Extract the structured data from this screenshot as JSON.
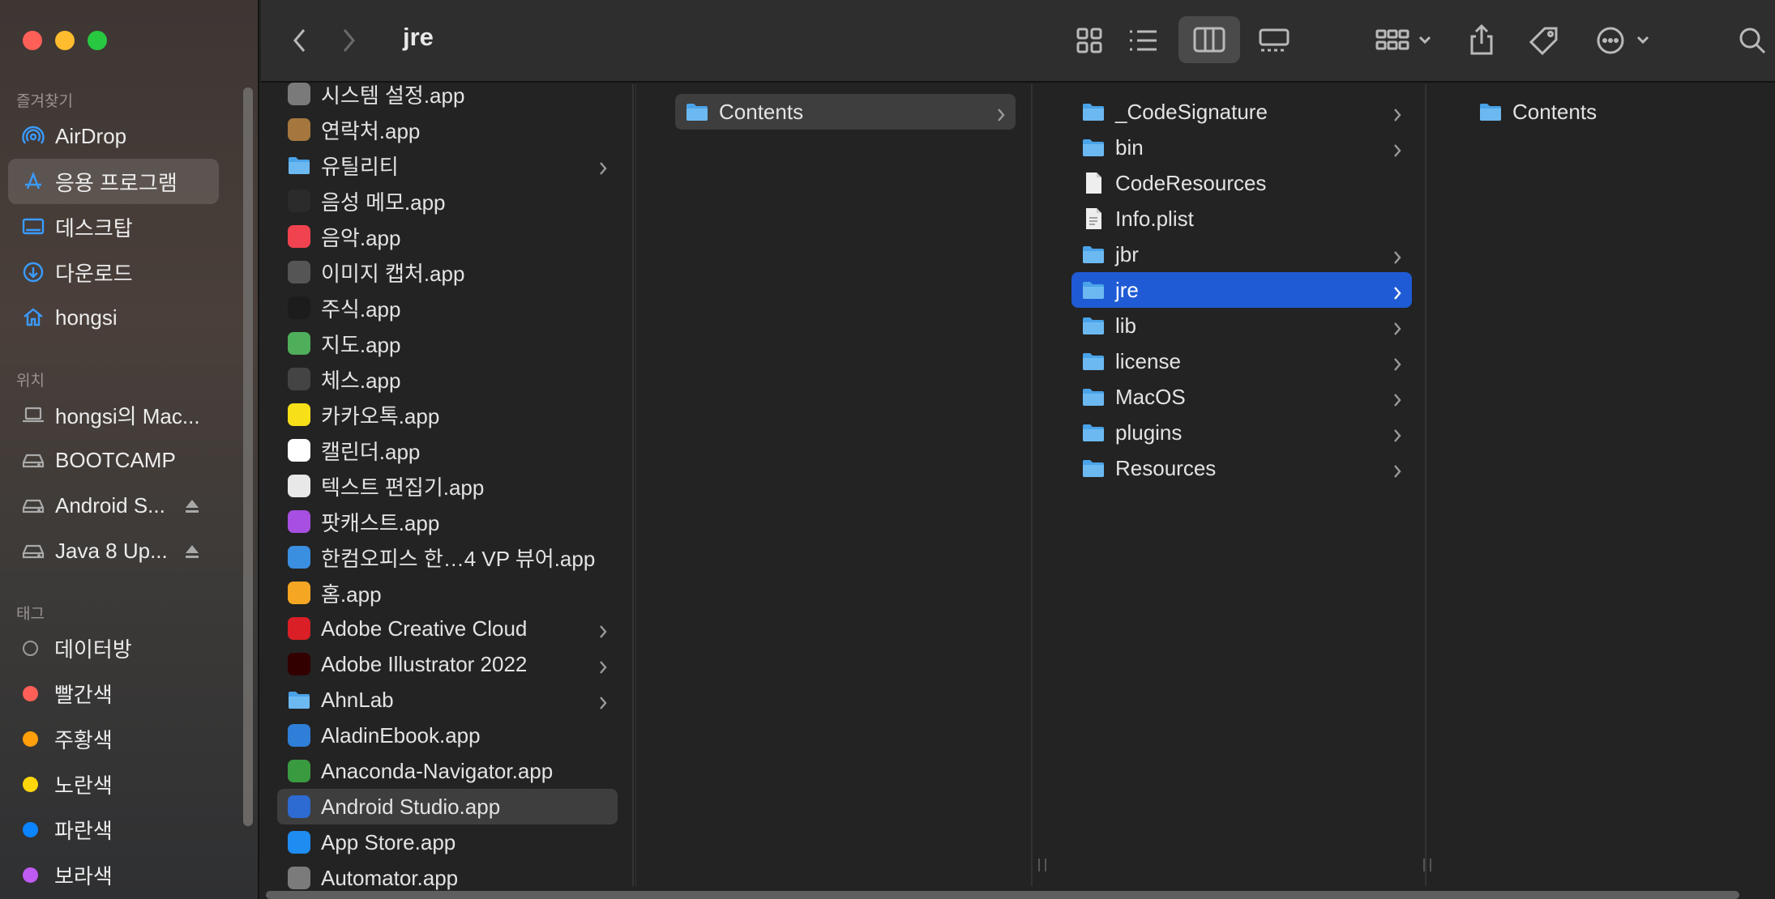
{
  "window": {
    "title": "jre"
  },
  "sidebar": {
    "favorites_title": "즐겨찾기",
    "favorites": [
      {
        "label": "AirDrop",
        "icon": "airdrop-icon"
      },
      {
        "label": "응용 프로그램",
        "icon": "applications-icon",
        "active": true
      },
      {
        "label": "데스크탑",
        "icon": "desktop-icon"
      },
      {
        "label": "다운로드",
        "icon": "downloads-icon"
      },
      {
        "label": "hongsi",
        "icon": "home-icon"
      }
    ],
    "locations_title": "위치",
    "locations": [
      {
        "label": "hongsi의 Mac...",
        "icon": "laptop-icon"
      },
      {
        "label": "BOOTCAMP",
        "icon": "drive-icon"
      },
      {
        "label": "Android S...",
        "icon": "drive-icon",
        "eject": true
      },
      {
        "label": "Java 8 Up...",
        "icon": "drive-icon",
        "eject": true
      }
    ],
    "tags_title": "태그",
    "tags": [
      {
        "label": "데이터방",
        "color": "none"
      },
      {
        "label": "빨간색",
        "color": "#ff5f57"
      },
      {
        "label": "주황색",
        "color": "#ff9f0a"
      },
      {
        "label": "노란색",
        "color": "#ffd60a"
      },
      {
        "label": "파란색",
        "color": "#0a84ff"
      },
      {
        "label": "보라색",
        "color": "#bf5af2"
      }
    ]
  },
  "column1": {
    "items": [
      {
        "label": "시스템 설정.app",
        "icon": "gear-icon",
        "color": "#7a7a7a"
      },
      {
        "label": "연락처.app",
        "icon": "contacts-icon",
        "color": "#a5773e"
      },
      {
        "label": "유틸리티",
        "icon": "folder-icon",
        "folder": true,
        "chevron": true
      },
      {
        "label": "음성 메모.app",
        "icon": "voice-memo-icon",
        "color": "#2b2b2b"
      },
      {
        "label": "음악.app",
        "icon": "music-icon",
        "color": "#f0434f"
      },
      {
        "label": "이미지 캡처.app",
        "icon": "camera-icon",
        "color": "#555555"
      },
      {
        "label": "주식.app",
        "icon": "stocks-icon",
        "color": "#1c1c1c"
      },
      {
        "label": "지도.app",
        "icon": "maps-icon",
        "color": "#4fae5a"
      },
      {
        "label": "체스.app",
        "icon": "chess-icon",
        "color": "#444444"
      },
      {
        "label": "카카오톡.app",
        "icon": "kakaotalk-icon",
        "color": "#f7e018"
      },
      {
        "label": "캘린더.app",
        "icon": "calendar-icon",
        "color": "#ffffff"
      },
      {
        "label": "텍스트 편집기.app",
        "icon": "textedit-icon",
        "color": "#e8e8e8"
      },
      {
        "label": "팟캐스트.app",
        "icon": "podcast-icon",
        "color": "#a74fe0"
      },
      {
        "label": "한컴오피스 한…4 VP 뷰어.app",
        "icon": "hancom-icon",
        "color": "#3a8fe0"
      },
      {
        "label": "홈.app",
        "icon": "home-app-icon",
        "color": "#f5a623"
      },
      {
        "label": "Adobe Creative Cloud",
        "icon": "creative-cloud-icon",
        "color": "#da1f26",
        "chevron": true
      },
      {
        "label": "Adobe Illustrator 2022",
        "icon": "illustrator-icon",
        "color": "#330000",
        "chevron": true
      },
      {
        "label": "AhnLab",
        "icon": "folder-icon",
        "folder": true,
        "chevron": true
      },
      {
        "label": "AladinEbook.app",
        "icon": "aladin-icon",
        "color": "#2f7ed8"
      },
      {
        "label": "Anaconda-Navigator.app",
        "icon": "anaconda-icon",
        "color": "#3a9a3f"
      },
      {
        "label": "Android Studio.app",
        "icon": "android-studio-icon",
        "color": "#2d6ad1",
        "selected": true
      },
      {
        "label": "App Store.app",
        "icon": "app-store-icon",
        "color": "#1e8cf0"
      },
      {
        "label": "Automator.app",
        "icon": "automator-icon",
        "color": "#7b7b7b"
      }
    ]
  },
  "column2": {
    "items": [
      {
        "label": "Contents",
        "icon": "folder-icon",
        "folder": true,
        "chevron": true,
        "selected": true
      }
    ]
  },
  "column3": {
    "items": [
      {
        "label": "_CodeSignature",
        "icon": "folder-icon",
        "folder": true,
        "chevron": true
      },
      {
        "label": "bin",
        "icon": "folder-icon",
        "folder": true,
        "chevron": true
      },
      {
        "label": "CodeResources",
        "icon": "document-icon",
        "file": true
      },
      {
        "label": "Info.plist",
        "icon": "plist-icon",
        "file": true
      },
      {
        "label": "jbr",
        "icon": "folder-icon",
        "folder": true,
        "chevron": true
      },
      {
        "label": "jre",
        "icon": "folder-icon",
        "folder": true,
        "chevron": true,
        "selected": true
      },
      {
        "label": "lib",
        "icon": "folder-icon",
        "folder": true,
        "chevron": true
      },
      {
        "label": "license",
        "icon": "folder-icon",
        "folder": true,
        "chevron": true
      },
      {
        "label": "MacOS",
        "icon": "folder-icon",
        "folder": true,
        "chevron": true
      },
      {
        "label": "plugins",
        "icon": "folder-icon",
        "folder": true,
        "chevron": true
      },
      {
        "label": "Resources",
        "icon": "folder-icon",
        "folder": true,
        "chevron": true
      }
    ]
  },
  "column4": {
    "items": [
      {
        "label": "Contents",
        "icon": "folder-icon",
        "folder": true
      }
    ]
  }
}
